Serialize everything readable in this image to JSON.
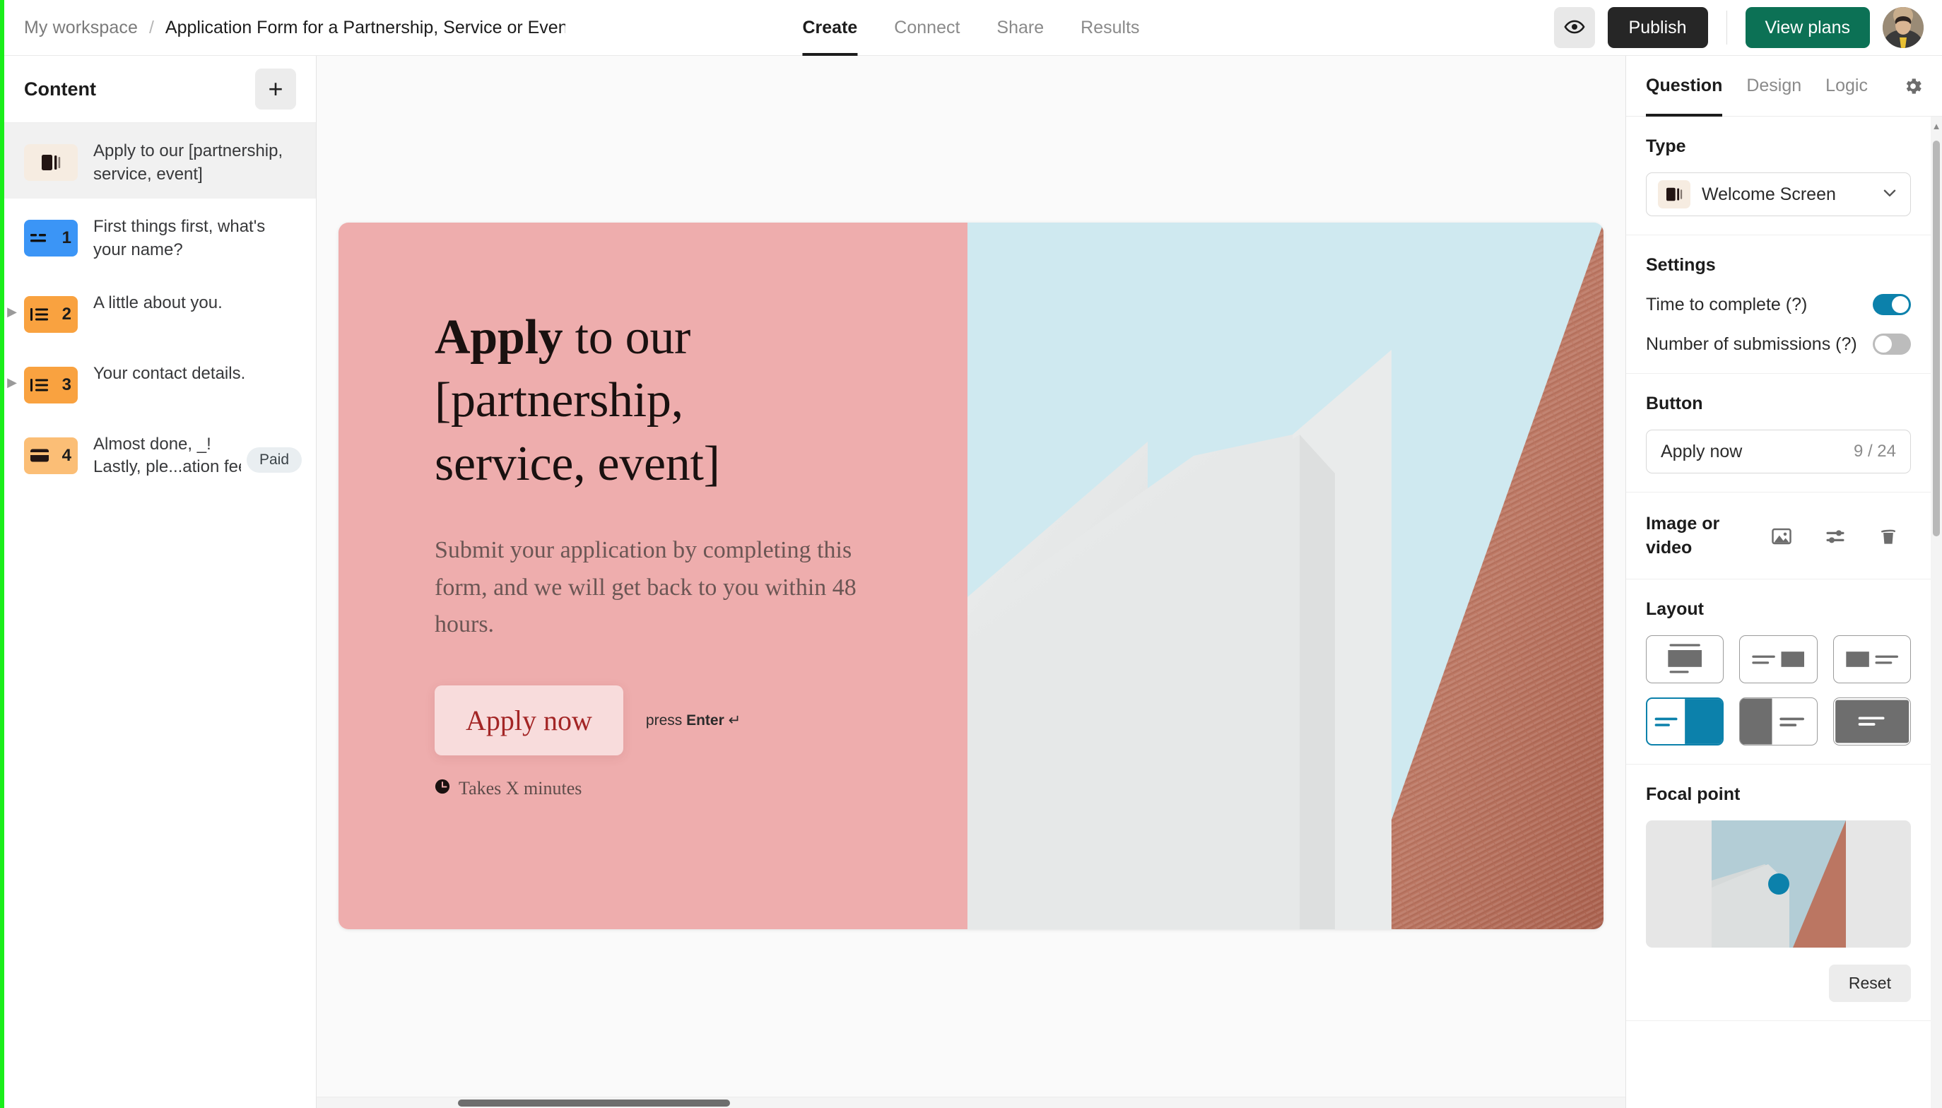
{
  "topbar": {
    "workspace": "My workspace",
    "separator": "/",
    "form_title": "Application Form for a Partnership, Service or Event Te",
    "tabs": [
      {
        "label": "Create",
        "active": true
      },
      {
        "label": "Connect",
        "active": false
      },
      {
        "label": "Share",
        "active": false
      },
      {
        "label": "Results",
        "active": false
      }
    ],
    "preview_icon": "eye-icon",
    "publish_label": "Publish",
    "view_plans_label": "View plans",
    "avatar_icon": "user-avatar"
  },
  "sidebar": {
    "title": "Content",
    "add_label": "+",
    "items": [
      {
        "badge": "",
        "badge_icon": "welcome-screen-icon",
        "badge_style": "welcome",
        "line1": "Apply to our [partnership,",
        "line2": "service, event]",
        "selected": true,
        "has_arrow": false,
        "pill": ""
      },
      {
        "badge": "1",
        "badge_icon": "short-text-icon",
        "badge_style": "blue",
        "line1": "First things first, what's",
        "line2": "your name?",
        "selected": false,
        "has_arrow": false,
        "pill": ""
      },
      {
        "badge": "2",
        "badge_icon": "question-group-icon",
        "badge_style": "orange",
        "line1": "A little about you.",
        "line2": "",
        "selected": false,
        "has_arrow": true,
        "pill": ""
      },
      {
        "badge": "3",
        "badge_icon": "question-group-icon",
        "badge_style": "orange",
        "line1": "Your contact details.",
        "line2": "",
        "selected": false,
        "has_arrow": true,
        "pill": ""
      },
      {
        "badge": "4",
        "badge_icon": "payment-card-icon",
        "badge_style": "orange-light",
        "line1": "Almost done, _!",
        "line2": "Lastly, ple...ation fee.",
        "selected": false,
        "has_arrow": false,
        "pill": "Paid"
      }
    ]
  },
  "canvas": {
    "headline_bold": "Apply",
    "headline_rest": " to our [partnership, service, event]",
    "subtext": "Submit your application by completing this form, and we will get back to you within 48 hours.",
    "cta_label": "Apply now",
    "press_enter_prefix": "press ",
    "press_enter_key": "Enter",
    "press_enter_symbol": "↵",
    "takes_icon": "clock-icon",
    "takes_label": "Takes X minutes",
    "bg_color": "#eeadad",
    "cta_bg_color": "#f8dcdc",
    "cta_text_color": "#a32525",
    "image": {
      "sky_color": "#cfe9f0",
      "brick_color": "#bf7965",
      "wall_color": "#e4e6e6"
    }
  },
  "rightpanel": {
    "tabs": [
      {
        "label": "Question",
        "active": true
      },
      {
        "label": "Design",
        "active": false
      },
      {
        "label": "Logic",
        "active": false
      }
    ],
    "settings_icon": "gear-icon",
    "type": {
      "label": "Type",
      "icon": "welcome-screen-icon",
      "value": "Welcome Screen",
      "chevron": "chevron-down-icon"
    },
    "settings": {
      "label": "Settings",
      "rows": [
        {
          "label": "Time to complete (?)",
          "on": true
        },
        {
          "label": "Number of submissions (?)",
          "on": false
        }
      ]
    },
    "button": {
      "label": "Button",
      "value": "Apply now",
      "counter": "9 / 24"
    },
    "image_or_video": {
      "label_line1": "Image or",
      "label_line2": "video",
      "icons": [
        "image-icon",
        "adjust-sliders-icon",
        "trash-icon"
      ]
    },
    "layout": {
      "label": "Layout",
      "options": [
        {
          "id": "stacked-center",
          "selected": false
        },
        {
          "id": "text-left-image-right-small",
          "selected": false
        },
        {
          "id": "image-left-text-right-small",
          "selected": false
        },
        {
          "id": "text-left-image-right-full",
          "selected": true
        },
        {
          "id": "image-left-full-text-right",
          "selected": false
        },
        {
          "id": "image-fullscreen-overlay",
          "selected": false
        }
      ]
    },
    "focal_point": {
      "label": "Focal point",
      "reset_label": "Reset",
      "dot_color": "#0c81ab"
    },
    "accent_color": "#0c81ab"
  }
}
